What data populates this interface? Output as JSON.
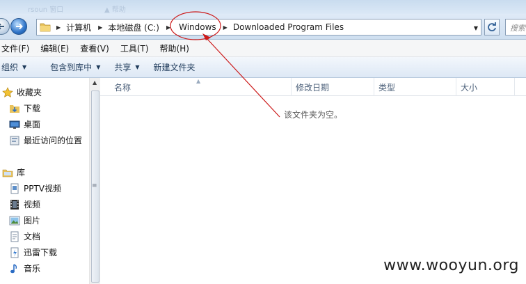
{
  "title_ghost": {
    "left": "rsoun 窗口",
    "right": "▲ 帮助"
  },
  "address": {
    "crumbs": [
      {
        "label": "计算机"
      },
      {
        "label": "本地磁盘 (C:)"
      },
      {
        "label": "Windows"
      },
      {
        "label": "Downloaded Program Files"
      }
    ],
    "search_placeholder": "搜索 Downloaded Program Files"
  },
  "menu": [
    "文件(F)",
    "编辑(E)",
    "查看(V)",
    "工具(T)",
    "帮助(H)"
  ],
  "commands": [
    {
      "label": "组织",
      "dropdown": true
    },
    {
      "label": "包含到库中",
      "dropdown": true
    },
    {
      "label": "共享",
      "dropdown": true
    },
    {
      "label": "新建文件夹",
      "dropdown": false
    }
  ],
  "nav": {
    "favorites": {
      "label": "收藏夹",
      "icon": "star-icon"
    },
    "favorite_items": [
      {
        "label": "下载",
        "icon": "download-folder-icon"
      },
      {
        "label": "桌面",
        "icon": "desktop-icon"
      },
      {
        "label": "最近访问的位置",
        "icon": "recent-places-icon"
      }
    ],
    "library": {
      "label": "库",
      "icon": "library-icon"
    },
    "library_items": [
      {
        "label": "PPTV视频",
        "icon": "pptv-video-icon"
      },
      {
        "label": "视频",
        "icon": "video-icon"
      },
      {
        "label": "图片",
        "icon": "pictures-icon"
      },
      {
        "label": "文档",
        "icon": "documents-icon"
      },
      {
        "label": "迅雷下载",
        "icon": "thunder-download-icon"
      },
      {
        "label": "音乐",
        "icon": "music-icon"
      }
    ]
  },
  "columns": [
    "名称",
    "修改日期",
    "类型",
    "大小"
  ],
  "empty_message": "该文件夹为空。",
  "watermark": "www.wooyun.org",
  "colors": {
    "annotation": "#cc1a1a",
    "accent": "#2f74c8"
  }
}
